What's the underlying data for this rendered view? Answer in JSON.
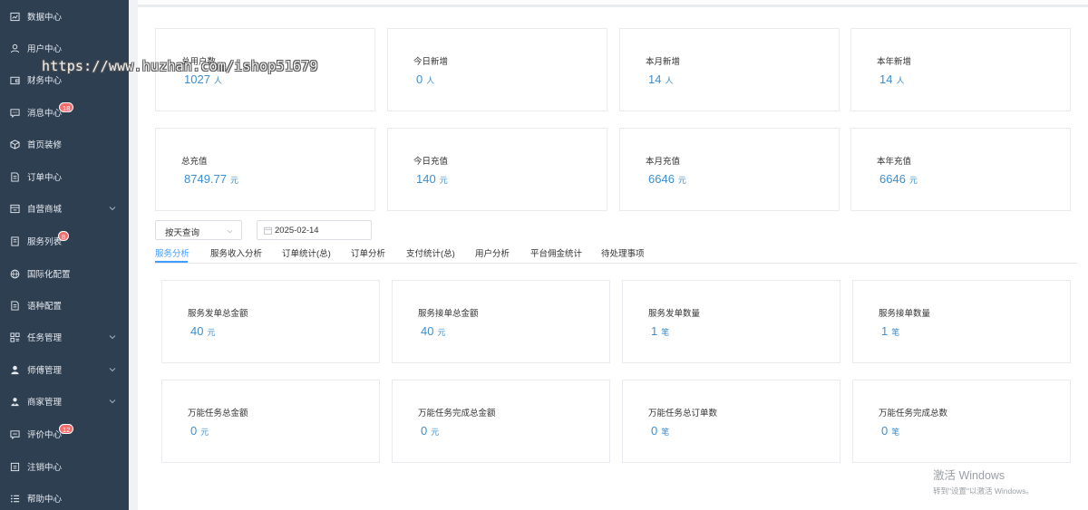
{
  "watermark": "https://www.huzhan.com/ishop51679",
  "sidebar": {
    "items": [
      {
        "label": "数据中心",
        "icon": "chart-icon"
      },
      {
        "label": "用户中心",
        "icon": "user-icon"
      },
      {
        "label": "财务中心",
        "icon": "wallet-icon"
      },
      {
        "label": "消息中心",
        "icon": "message-icon",
        "badge": "18"
      },
      {
        "label": "首页装修",
        "icon": "cube-icon"
      },
      {
        "label": "订单中心",
        "icon": "document-icon"
      },
      {
        "label": "自营商城",
        "icon": "shop-icon",
        "expandable": true
      },
      {
        "label": "服务列表",
        "icon": "list-icon",
        "badge": "8"
      },
      {
        "label": "国际化配置",
        "icon": "globe-icon"
      },
      {
        "label": "语种配置",
        "icon": "document-icon"
      },
      {
        "label": "任务管理",
        "icon": "grid-icon",
        "expandable": true
      },
      {
        "label": "师傅管理",
        "icon": "person-icon",
        "expandable": true
      },
      {
        "label": "商家管理",
        "icon": "merchant-icon",
        "expandable": true
      },
      {
        "label": "评价中心",
        "icon": "comment-icon",
        "badge": "12"
      },
      {
        "label": "注销中心",
        "icon": "logout-icon"
      },
      {
        "label": "帮助中心",
        "icon": "help-list-icon"
      }
    ]
  },
  "stats_top": [
    {
      "label": "总用户数",
      "value": "1027",
      "unit": "人"
    },
    {
      "label": "今日新增",
      "value": "0",
      "unit": "人"
    },
    {
      "label": "本月新增",
      "value": "14",
      "unit": "人"
    },
    {
      "label": "本年新增",
      "value": "14",
      "unit": "人"
    },
    {
      "label": "总充值",
      "value": "8749.77",
      "unit": "元"
    },
    {
      "label": "今日充值",
      "value": "140",
      "unit": "元"
    },
    {
      "label": "本月充值",
      "value": "6646",
      "unit": "元"
    },
    {
      "label": "本年充值",
      "value": "6646",
      "unit": "元"
    }
  ],
  "filters": {
    "mode": "按天查询",
    "date": "2025-02-14"
  },
  "tabs": [
    "服务分析",
    "服务收入分析",
    "订单统计(总)",
    "订单分析",
    "支付统计(总)",
    "用户分析",
    "平台佣金统计",
    "待处理事项"
  ],
  "active_tab": "服务分析",
  "stats_service": [
    {
      "label": "服务发单总金额",
      "value": "40",
      "unit": "元"
    },
    {
      "label": "服务接单总金额",
      "value": "40",
      "unit": "元"
    },
    {
      "label": "服务发单数量",
      "value": "1",
      "unit": "笔"
    },
    {
      "label": "服务接单数量",
      "value": "1",
      "unit": "笔"
    },
    {
      "label": "万能任务总金额",
      "value": "0",
      "unit": "元"
    },
    {
      "label": "万能任务完成总金额",
      "value": "0",
      "unit": "元"
    },
    {
      "label": "万能任务总订单数",
      "value": "0",
      "unit": "笔"
    },
    {
      "label": "万能任务完成总数",
      "value": "0",
      "unit": "笔"
    }
  ],
  "os_notice": {
    "title": "激活 Windows",
    "subtitle": "转到\"设置\"以激活 Windows。"
  },
  "colors": {
    "sidebar_bg": "#2f3f52",
    "accent": "#409eff",
    "value_text": "#3b8fd1",
    "badge": "#f56c6c"
  }
}
